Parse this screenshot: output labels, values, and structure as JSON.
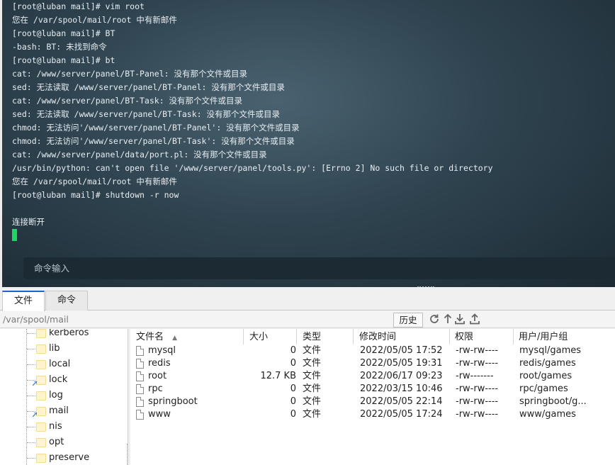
{
  "terminal": {
    "lines": [
      "[root@luban mail]# vim root",
      "您在 /var/spool/mail/root 中有新邮件",
      "[root@luban mail]# BT",
      "-bash: BT: 未找到命令",
      "[root@luban mail]# bt",
      "cat: /www/server/panel/BT-Panel: 没有那个文件或目录",
      "sed: 无法读取 /www/server/panel/BT-Panel: 没有那个文件或目录",
      "cat: /www/server/panel/BT-Task: 没有那个文件或目录",
      "sed: 无法读取 /www/server/panel/BT-Task: 没有那个文件或目录",
      "chmod: 无法访问'/www/server/panel/BT-Panel': 没有那个文件或目录",
      "chmod: 无法访问'/www/server/panel/BT-Task': 没有那个文件或目录",
      "cat: /www/server/panel/data/port.pl: 没有那个文件或目录",
      "/usr/bin/python: can't open file '/www/server/panel/tools.py': [Errno 2] No such file or directory",
      "您在 /var/spool/mail/root 中有新邮件",
      "[root@luban mail]# shutdown -r now",
      "",
      "连接断开"
    ],
    "command_placeholder": "命令输入",
    "cursor_color": "#1ed760"
  },
  "tabs": [
    {
      "label": "文件",
      "active": true
    },
    {
      "label": "命令",
      "active": false
    }
  ],
  "pathbar": {
    "path": "/var/spool/mail",
    "history_label": "历史",
    "icons": [
      "refresh-icon",
      "up-arrow-icon",
      "download-icon",
      "upload-icon"
    ]
  },
  "tree": {
    "items": [
      {
        "label": "kerberos",
        "link": false
      },
      {
        "label": "lib",
        "link": false
      },
      {
        "label": "local",
        "link": false
      },
      {
        "label": "lock",
        "link": true
      },
      {
        "label": "log",
        "link": false
      },
      {
        "label": "mail",
        "link": true
      },
      {
        "label": "nis",
        "link": false
      },
      {
        "label": "opt",
        "link": false
      },
      {
        "label": "preserve",
        "link": false
      }
    ]
  },
  "filelist": {
    "columns": [
      "文件名",
      "大小",
      "类型",
      "修改时间",
      "权限",
      "用户/用户组"
    ],
    "sort_indicator": "▲",
    "rows": [
      {
        "name": "mysql",
        "size": "0",
        "type": "文件",
        "mtime": "2022/05/05 17:52",
        "perm": "-rw-rw----",
        "owner": "mysql/games"
      },
      {
        "name": "redis",
        "size": "0",
        "type": "文件",
        "mtime": "2022/05/05 19:31",
        "perm": "-rw-rw----",
        "owner": "redis/games"
      },
      {
        "name": "root",
        "size": "12.7 KB",
        "type": "文件",
        "mtime": "2022/06/17 09:23",
        "perm": "-rw-------",
        "owner": "root/games"
      },
      {
        "name": "rpc",
        "size": "0",
        "type": "文件",
        "mtime": "2022/03/15 10:46",
        "perm": "-rw-rw----",
        "owner": "rpc/games"
      },
      {
        "name": "springboot",
        "size": "0",
        "type": "文件",
        "mtime": "2022/05/05 22:14",
        "perm": "-rw-rw----",
        "owner": "springboot/g..."
      },
      {
        "name": "www",
        "size": "0",
        "type": "文件",
        "mtime": "2022/05/05 17:24",
        "perm": "-rw-rw----",
        "owner": "www/games"
      }
    ]
  }
}
